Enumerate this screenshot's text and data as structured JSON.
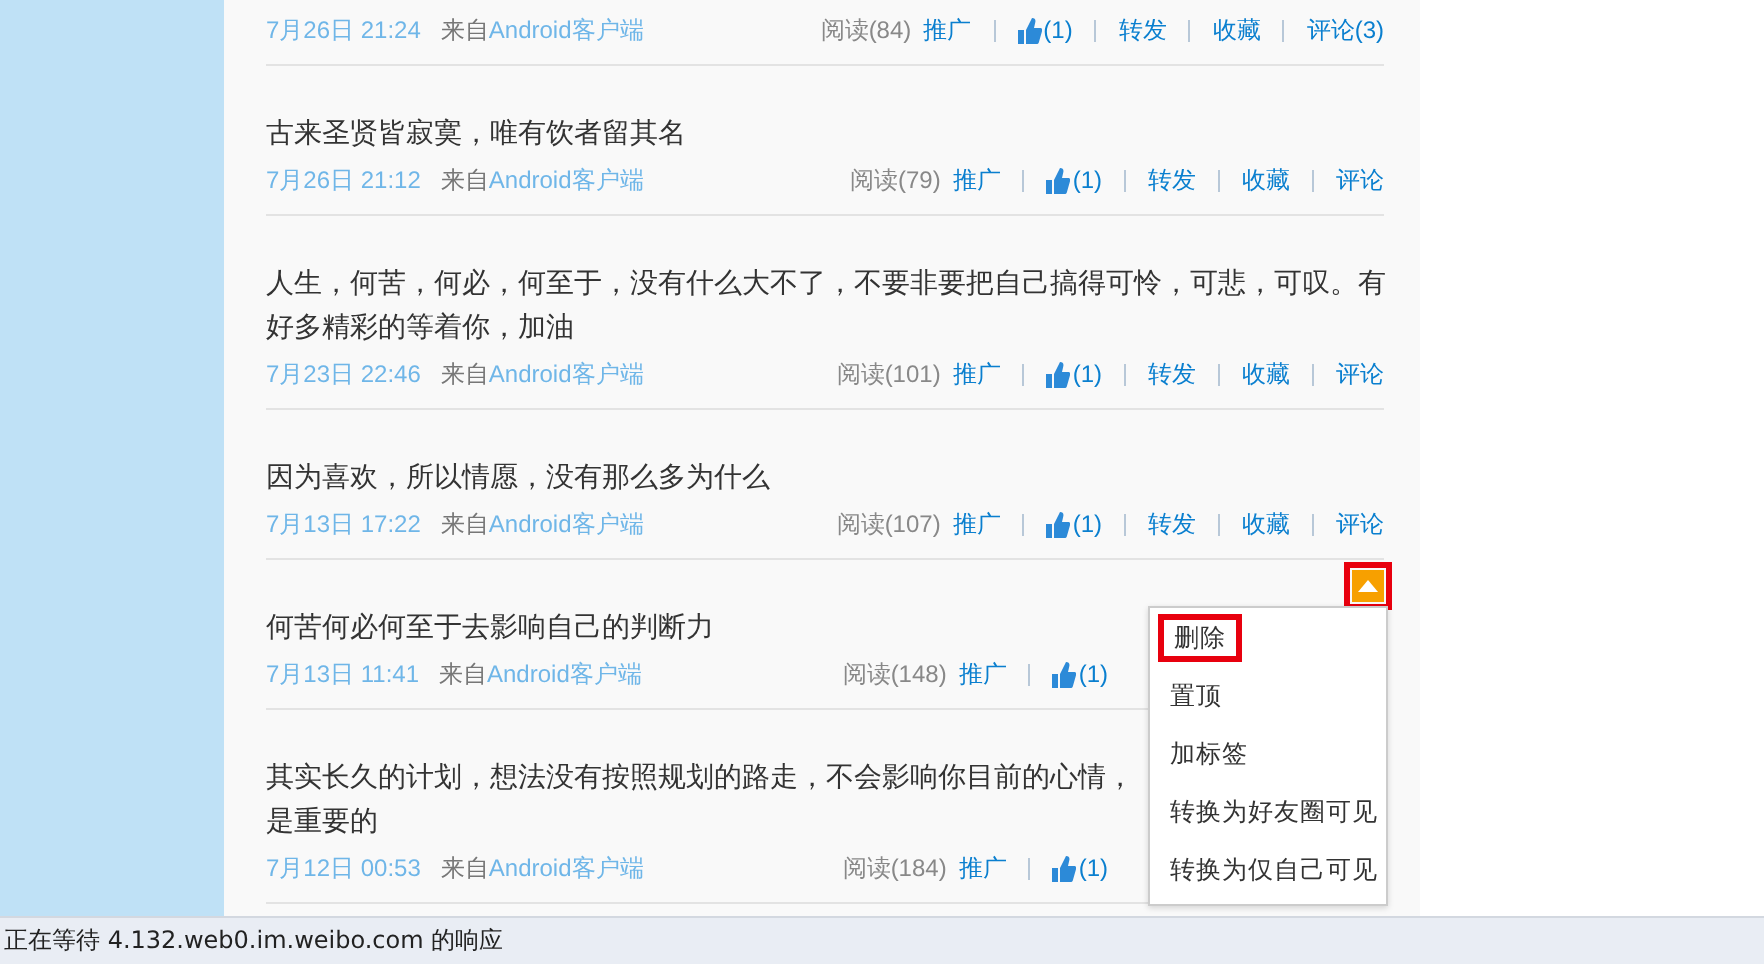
{
  "feed": [
    {
      "date": "7月26日 21:24",
      "source_prefix": "来自",
      "source": "Android客户端",
      "reads": "阅读(84)",
      "actions": [
        {
          "kind": "link",
          "label": "推广"
        },
        {
          "kind": "like",
          "label": "(1)"
        },
        {
          "kind": "link",
          "label": "转发"
        },
        {
          "kind": "link",
          "label": "收藏"
        },
        {
          "kind": "link",
          "label": "评论(3)"
        }
      ]
    },
    {
      "lines": [
        "古来圣贤皆寂寞，唯有饮者留其名"
      ],
      "date": "7月26日 21:12",
      "source_prefix": "来自",
      "source": "Android客户端",
      "reads": "阅读(79)",
      "actions": [
        {
          "kind": "link",
          "label": "推广"
        },
        {
          "kind": "like",
          "label": "(1)"
        },
        {
          "kind": "link",
          "label": "转发"
        },
        {
          "kind": "link",
          "label": "收藏"
        },
        {
          "kind": "link",
          "label": "评论"
        }
      ]
    },
    {
      "lines": [
        "人生，何苦，何必，何至于，没有什么大不了，不要非要把自己搞得可怜，可悲，可叹。有",
        "好多精彩的等着你，加油"
      ],
      "date": "7月23日 22:46",
      "source_prefix": "来自",
      "source": "Android客户端",
      "reads": "阅读(101)",
      "actions": [
        {
          "kind": "link",
          "label": "推广"
        },
        {
          "kind": "like",
          "label": "(1)"
        },
        {
          "kind": "link",
          "label": "转发"
        },
        {
          "kind": "link",
          "label": "收藏"
        },
        {
          "kind": "link",
          "label": "评论"
        }
      ]
    },
    {
      "lines": [
        "因为喜欢，所以情愿，没有那么多为什么"
      ],
      "date": "7月13日 17:22",
      "source_prefix": "来自",
      "source": "Android客户端",
      "reads": "阅读(107)",
      "actions": [
        {
          "kind": "link",
          "label": "推广"
        },
        {
          "kind": "like",
          "label": "(1)"
        },
        {
          "kind": "link",
          "label": "转发"
        },
        {
          "kind": "link",
          "label": "收藏"
        },
        {
          "kind": "link",
          "label": "评论"
        }
      ]
    },
    {
      "lines": [
        "何苦何必何至于去影响自己的判断力"
      ],
      "date": "7月13日 11:41",
      "source_prefix": "来自",
      "source": "Android客户端",
      "reads": "阅读(148)",
      "actions": [
        {
          "kind": "link",
          "label": "推广"
        },
        {
          "kind": "like",
          "label": "(1)"
        }
      ]
    },
    {
      "lines": [
        "其实长久的计划，想法没有按照规划的路走，不会影响你目前的心情，",
        "是重要的"
      ],
      "date": "7月12日 00:53",
      "source_prefix": "来自",
      "source": "Android客户端",
      "reads": "阅读(184)",
      "actions": [
        {
          "kind": "link",
          "label": "推广"
        },
        {
          "kind": "like",
          "label": "(1)"
        }
      ]
    }
  ],
  "menu_toggle": {
    "highlighted": true
  },
  "menu": [
    {
      "label": "删除",
      "highlighted": true
    },
    {
      "label": "置顶",
      "highlighted": false
    },
    {
      "label": "加标签",
      "highlighted": false
    },
    {
      "label": "转换为好友圈可见",
      "highlighted": false
    },
    {
      "label": "转换为仅自己可见",
      "highlighted": false
    }
  ],
  "status_bar": "正在等待 4.132.web0.im.weibo.com 的响应"
}
